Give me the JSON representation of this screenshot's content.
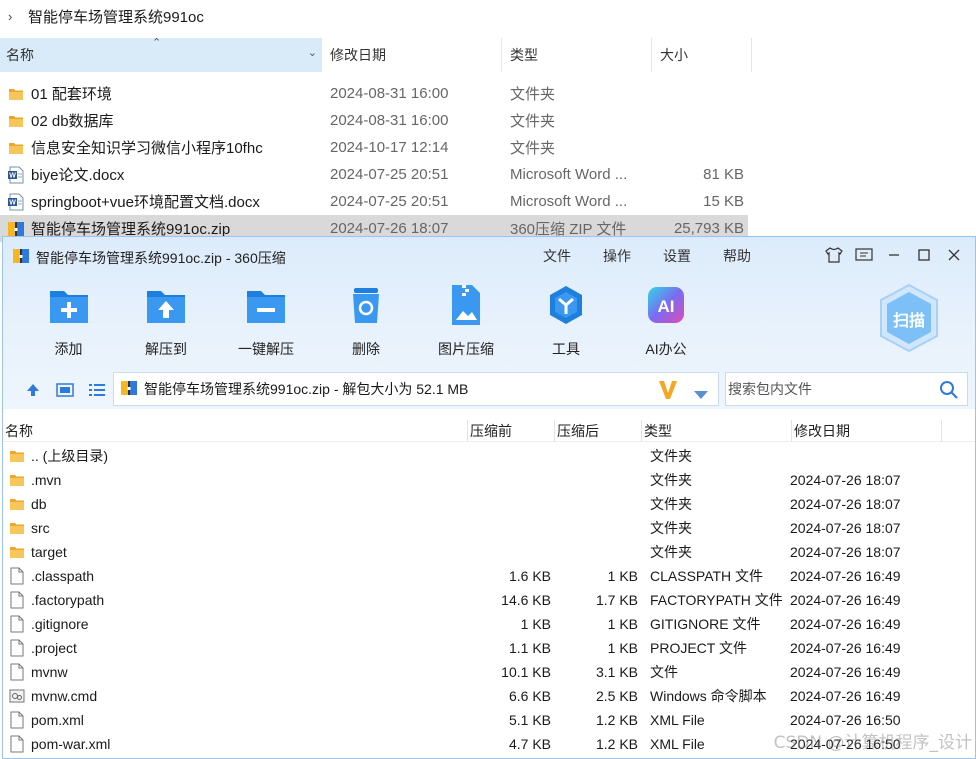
{
  "explorer": {
    "breadcrumb": "智能停车场管理系统991oc",
    "columns": {
      "name": "名称",
      "date": "修改日期",
      "type": "类型",
      "size": "大小"
    },
    "rows": [
      {
        "name": "01 配套环境",
        "date": "2024-08-31 16:00",
        "type": "文件夹",
        "size": "",
        "icon": "folder-icon"
      },
      {
        "name": "02 db数据库",
        "date": "2024-08-31 16:00",
        "type": "文件夹",
        "size": "",
        "icon": "folder-icon"
      },
      {
        "name": "信息安全知识学习微信小程序10fhc",
        "date": "2024-10-17 12:14",
        "type": "文件夹",
        "size": "",
        "icon": "folder-icon"
      },
      {
        "name": "biye论文.docx",
        "date": "2024-07-25 20:51",
        "type": "Microsoft Word ...",
        "size": "81 KB",
        "icon": "word-doc-icon"
      },
      {
        "name": "springboot+vue环境配置文档.docx",
        "date": "2024-07-25 20:51",
        "type": "Microsoft Word ...",
        "size": "15 KB",
        "icon": "word-doc-icon"
      },
      {
        "name": "智能停车场管理系统991oc.zip",
        "date": "2024-07-26 18:07",
        "type": "360压缩 ZIP 文件",
        "size": "25,793 KB",
        "icon": "zip-archive-icon"
      }
    ]
  },
  "zip": {
    "title": "智能停车场管理系统991oc.zip - 360压缩",
    "menu": [
      "文件",
      "操作",
      "设置",
      "帮助"
    ],
    "tools": [
      {
        "label": "添加",
        "icon": "add-icon"
      },
      {
        "label": "解压到",
        "icon": "extract-to-icon"
      },
      {
        "label": "一键解压",
        "icon": "one-click-extract-icon"
      },
      {
        "label": "删除",
        "icon": "delete-icon"
      },
      {
        "label": "图片压缩",
        "icon": "image-compress-icon"
      },
      {
        "label": "工具",
        "icon": "tools-icon"
      },
      {
        "label": "AI办公",
        "icon": "ai-office-icon"
      }
    ],
    "scan_label": "扫描",
    "address": "智能停车场管理系统991oc.zip - 解包大小为 52.1 MB",
    "search_placeholder": "搜索包内文件",
    "columns": {
      "name": "名称",
      "before": "压缩前",
      "after": "压缩后",
      "type": "类型",
      "date": "修改日期"
    },
    "rows": [
      {
        "name": ".. (上级目录)",
        "before": "",
        "after": "",
        "type": "文件夹",
        "date": "",
        "icon": "folder-icon"
      },
      {
        "name": ".mvn",
        "before": "",
        "after": "",
        "type": "文件夹",
        "date": "2024-07-26 18:07",
        "icon": "folder-icon"
      },
      {
        "name": "db",
        "before": "",
        "after": "",
        "type": "文件夹",
        "date": "2024-07-26 18:07",
        "icon": "folder-icon"
      },
      {
        "name": "src",
        "before": "",
        "after": "",
        "type": "文件夹",
        "date": "2024-07-26 18:07",
        "icon": "folder-icon"
      },
      {
        "name": "target",
        "before": "",
        "after": "",
        "type": "文件夹",
        "date": "2024-07-26 18:07",
        "icon": "folder-icon"
      },
      {
        "name": ".classpath",
        "before": "1.6 KB",
        "after": "1 KB",
        "type": "CLASSPATH 文件",
        "date": "2024-07-26 16:49",
        "icon": "file-icon"
      },
      {
        "name": ".factorypath",
        "before": "14.6 KB",
        "after": "1.7 KB",
        "type": "FACTORYPATH 文件",
        "date": "2024-07-26 16:49",
        "icon": "file-icon"
      },
      {
        "name": ".gitignore",
        "before": "1 KB",
        "after": "1 KB",
        "type": "GITIGNORE 文件",
        "date": "2024-07-26 16:49",
        "icon": "file-icon"
      },
      {
        "name": ".project",
        "before": "1.1 KB",
        "after": "1 KB",
        "type": "PROJECT 文件",
        "date": "2024-07-26 16:49",
        "icon": "file-icon"
      },
      {
        "name": "mvnw",
        "before": "10.1 KB",
        "after": "3.1 KB",
        "type": "文件",
        "date": "2024-07-26 16:49",
        "icon": "file-icon"
      },
      {
        "name": "mvnw.cmd",
        "before": "6.6 KB",
        "after": "2.5 KB",
        "type": "Windows 命令脚本",
        "date": "2024-07-26 16:49",
        "icon": "cmd-script-icon"
      },
      {
        "name": "pom.xml",
        "before": "5.1 KB",
        "after": "1.2 KB",
        "type": "XML File",
        "date": "2024-07-26 16:50",
        "icon": "file-icon"
      },
      {
        "name": "pom-war.xml",
        "before": "4.7 KB",
        "after": "1.2 KB",
        "type": "XML File",
        "date": "2024-07-26 16:50",
        "icon": "file-icon"
      }
    ]
  },
  "watermark": "CSDN @计算机程序_设计"
}
